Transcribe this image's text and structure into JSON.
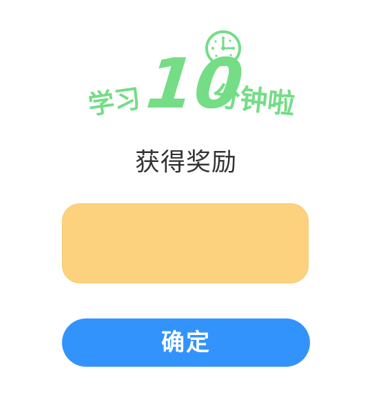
{
  "banner": {
    "prefix": "学习",
    "number": "10",
    "suffix": "分钟啦",
    "clock_icon": "clock-icon",
    "color": "#74dd86"
  },
  "subtitle": "获得奖励",
  "reward_box": {
    "color": "#fdd27f"
  },
  "confirm_button": {
    "label": "确定",
    "color": "#3393fd"
  }
}
